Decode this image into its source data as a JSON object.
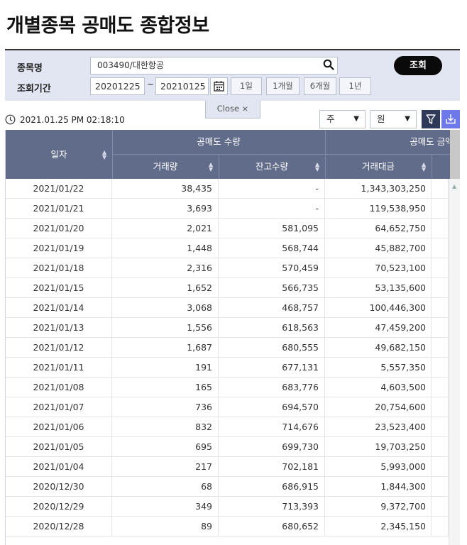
{
  "page": {
    "title": "개별종목 공매도 종합정보"
  },
  "search": {
    "stock_label": "종목명",
    "stock_value": "003490/대한항공",
    "period_label": "조회기간",
    "date_from": "20201225",
    "date_separator": "~",
    "date_to": "20210125",
    "period_buttons": [
      "1일",
      "1개월",
      "6개월",
      "1년"
    ],
    "submit_label": "조회",
    "close_label": "Close ×"
  },
  "toolbar": {
    "timestamp": "2021.01.25 PM 02:18:10",
    "period_select": "주",
    "unit_select": "원",
    "icons": {
      "clock": "clock-icon",
      "search": "search-icon",
      "calendar": "calendar-icon",
      "filter": "filter-icon",
      "download": "download-icon"
    }
  },
  "table": {
    "headers": {
      "date": "일자",
      "group_volume": "공매도 수량",
      "group_amount": "공매도 금액",
      "trade_volume": "거래량",
      "balance_qty": "잔고수량",
      "trade_amount": "거래대금"
    },
    "rows": [
      {
        "date": "2021/01/22",
        "volume": "38,435",
        "balance": "-",
        "amount": "1,343,303,250"
      },
      {
        "date": "2021/01/21",
        "volume": "3,693",
        "balance": "-",
        "amount": "119,538,950"
      },
      {
        "date": "2021/01/20",
        "volume": "2,021",
        "balance": "581,095",
        "amount": "64,652,750"
      },
      {
        "date": "2021/01/19",
        "volume": "1,448",
        "balance": "568,744",
        "amount": "45,882,700"
      },
      {
        "date": "2021/01/18",
        "volume": "2,316",
        "balance": "570,459",
        "amount": "70,523,100"
      },
      {
        "date": "2021/01/15",
        "volume": "1,652",
        "balance": "566,735",
        "amount": "53,135,600"
      },
      {
        "date": "2021/01/14",
        "volume": "3,068",
        "balance": "468,757",
        "amount": "100,446,300"
      },
      {
        "date": "2021/01/13",
        "volume": "1,556",
        "balance": "618,563",
        "amount": "47,459,200"
      },
      {
        "date": "2021/01/12",
        "volume": "1,687",
        "balance": "680,555",
        "amount": "49,682,150"
      },
      {
        "date": "2021/01/11",
        "volume": "191",
        "balance": "677,131",
        "amount": "5,557,350"
      },
      {
        "date": "2021/01/08",
        "volume": "165",
        "balance": "683,776",
        "amount": "4,603,500"
      },
      {
        "date": "2021/01/07",
        "volume": "736",
        "balance": "694,570",
        "amount": "20,754,600"
      },
      {
        "date": "2021/01/06",
        "volume": "832",
        "balance": "714,676",
        "amount": "23,523,400"
      },
      {
        "date": "2021/01/05",
        "volume": "695",
        "balance": "699,730",
        "amount": "19,703,250"
      },
      {
        "date": "2021/01/04",
        "volume": "217",
        "balance": "702,181",
        "amount": "5,993,000"
      },
      {
        "date": "2020/12/30",
        "volume": "68",
        "balance": "686,915",
        "amount": "1,844,300"
      },
      {
        "date": "2020/12/29",
        "volume": "349",
        "balance": "713,393",
        "amount": "9,372,700"
      },
      {
        "date": "2020/12/28",
        "volume": "89",
        "balance": "680,652",
        "amount": "2,345,150"
      }
    ]
  },
  "colors": {
    "header_bg": "#606c8a",
    "panel_bg": "#e2e6f3",
    "download_bg": "#6d79e8",
    "filter_bg": "#2f3a59"
  }
}
